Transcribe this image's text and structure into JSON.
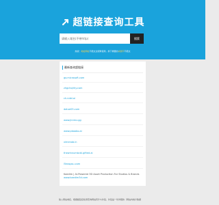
{
  "header": {
    "title": "超链接查询工具",
    "logo_icon": "link-arrow-icon",
    "bg_color": "#1aa3dc"
  },
  "search": {
    "placeholder": "请输入域名(不带http)",
    "button_label": "搜索"
  },
  "tips": {
    "prefix": "热搜：",
    "highlight1": "地址网址",
    "middle": "不能太过频繁使用，换下重要的",
    "highlight2": "关键字",
    "suffix": "不能太"
  },
  "results": {
    "heading": "最新查询超链接",
    "domains": [
      "go.microsoft.com",
      "zhgchqlrhy.com",
      "ch.ndel.ai",
      "datue05.com",
      "www.jinrmz.gg",
      "www.pbaobo.ai",
      "ximenab.in",
      "thewinnumbcbl.gifted.ai",
      "l5eospsu.com",
      "Kaedim | AI-Powered 3D Asset Production For Studios & Brands",
      "www.kaedim3d.com"
    ]
  },
  "footer": {
    "text": "输入网站域名，根据超链接检测查询网站有什么外链，外链是一份详细的（网站内统计数据"
  }
}
